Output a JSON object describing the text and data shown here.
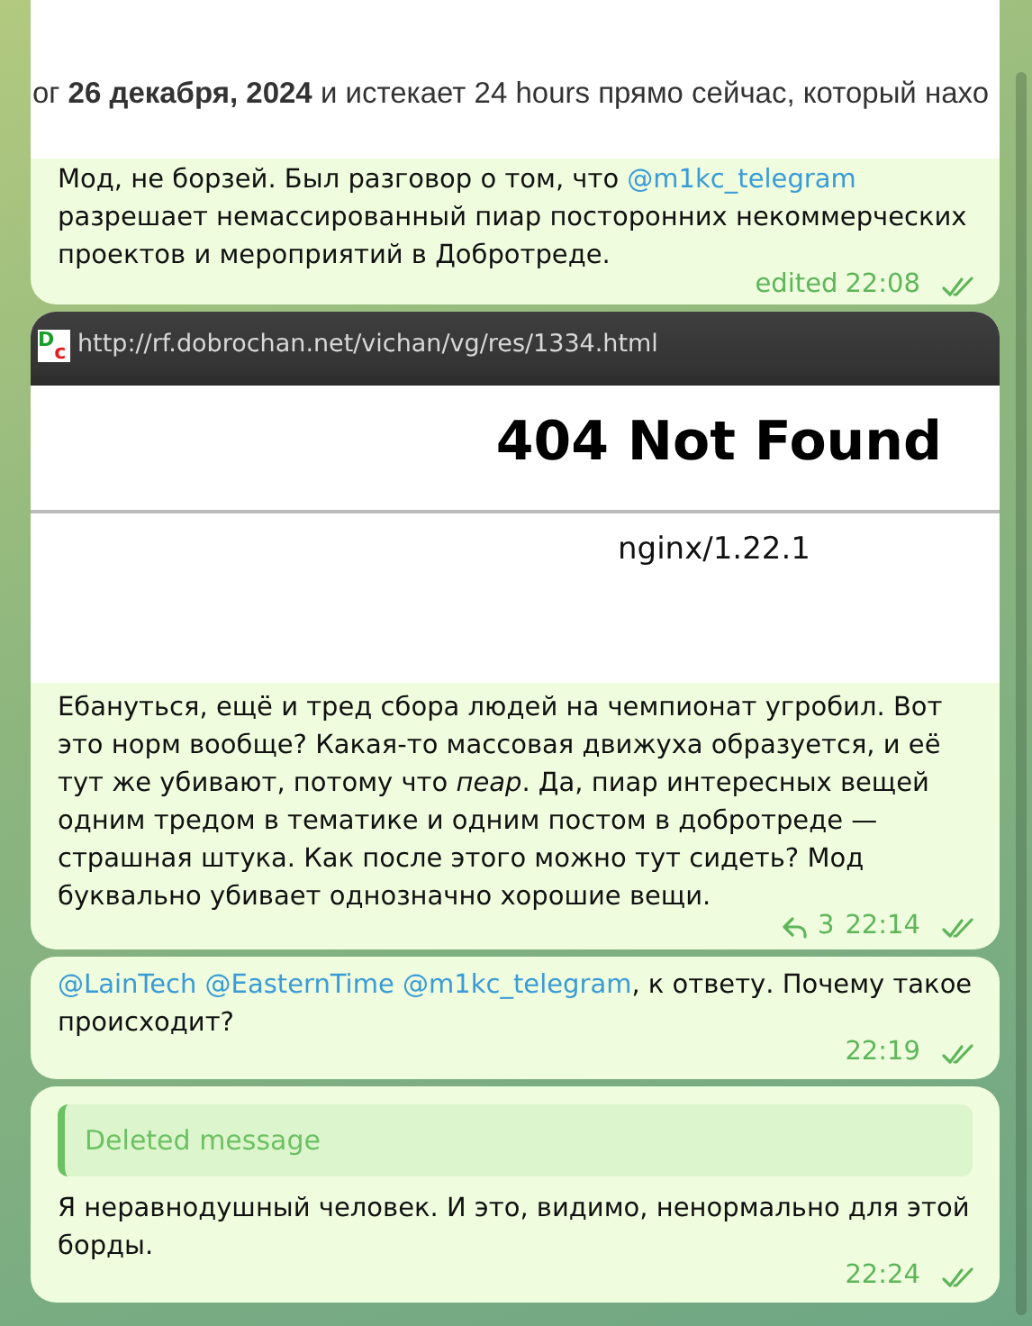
{
  "messages": [
    {
      "kind": "doc_screenshot",
      "screenshot_text": "ог **26 декабря, 2024** и истекает 24 hours прямо сейчас, который нахо",
      "text": [
        {
          "kind": "plain",
          "text": "Мод, не борзей. Был разговор о том, что "
        },
        {
          "kind": "mention",
          "text": "@m1kc_telegram"
        },
        {
          "kind": "plain",
          "text": " разрешает немассированный пиар посторонних некоммерческих проектов и мероприятий в Добротреде."
        }
      ],
      "edited": "edited",
      "time": "22:08",
      "read": true
    },
    {
      "kind": "browser_screenshot",
      "url": "http://rf.dobrochan.net/vichan/vg/res/1334.html",
      "favicon": [
        "D",
        "c"
      ],
      "heading": "404 Not Found",
      "server": "nginx/1.22.1",
      "text": [
        {
          "kind": "rich",
          "text": "Ебануться, ещё и тред сбора людей на чемпионат угробил. Вот это норм вообще? Какая-то массовая движуха образуется, и её тут же убивают, потому что *пеар*. Да, пиар интересных вещей одним тредом в тематике и одним постом в добротреде — страшная штука. Как после этого можно тут сидеть? Мод буквально убивает однозначно хорошие вещи."
        }
      ],
      "replies": "3",
      "time": "22:14",
      "read": true
    },
    {
      "kind": "plain",
      "text": [
        {
          "kind": "mention",
          "text": "@LainTech"
        },
        {
          "kind": "mention",
          "text": "@EasternTime"
        },
        {
          "kind": "mention",
          "text": "@m1kc_telegram"
        },
        {
          "kind": "plain",
          "text": ", к ответу. Почему такое происходит?"
        }
      ],
      "time": "22:19",
      "read": true
    },
    {
      "kind": "reply",
      "quote": "Deleted message",
      "text": [
        {
          "kind": "plain",
          "text": "Я неравнодушный человек. И это, видимо, ненормально для этой борды."
        }
      ],
      "time": "22:24",
      "read": true
    }
  ]
}
